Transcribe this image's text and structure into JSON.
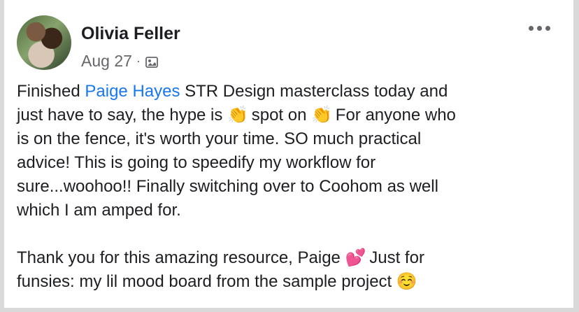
{
  "post": {
    "author": "Olivia Feller",
    "date": "Aug 27",
    "separator": "·",
    "audience_icon": "photo-icon",
    "more_icon": "more-options-icon",
    "paragraph1": {
      "before_mention": "Finished ",
      "mention": "Paige Hayes",
      "line1_after_mention": " STR Design masterclass today and",
      "line2_part1": "just have to say, the hype is ",
      "clap_emoji": "👏",
      "line2_part2": " spot on ",
      "line2_part3": " For anyone who",
      "line3": "is on the fence, it's worth your time. SO much practical",
      "line4": "advice! This is going to speedify my workflow for",
      "line5": "sure...woohoo!! Finally switching over to Coohom as well",
      "line6": "which I am amped for."
    },
    "paragraph2": {
      "line1_part1": "Thank you for this amazing resource, Paige ",
      "heart_emoji": "💕",
      "line1_part2": " Just for",
      "line2_part1": "funsies: my lil mood board from the sample project ",
      "smile_emoji": "☺️"
    }
  },
  "colors": {
    "name": "#1c1e21",
    "meta": "#65676b",
    "mention": "#1877f2",
    "background": "#ffffff"
  }
}
